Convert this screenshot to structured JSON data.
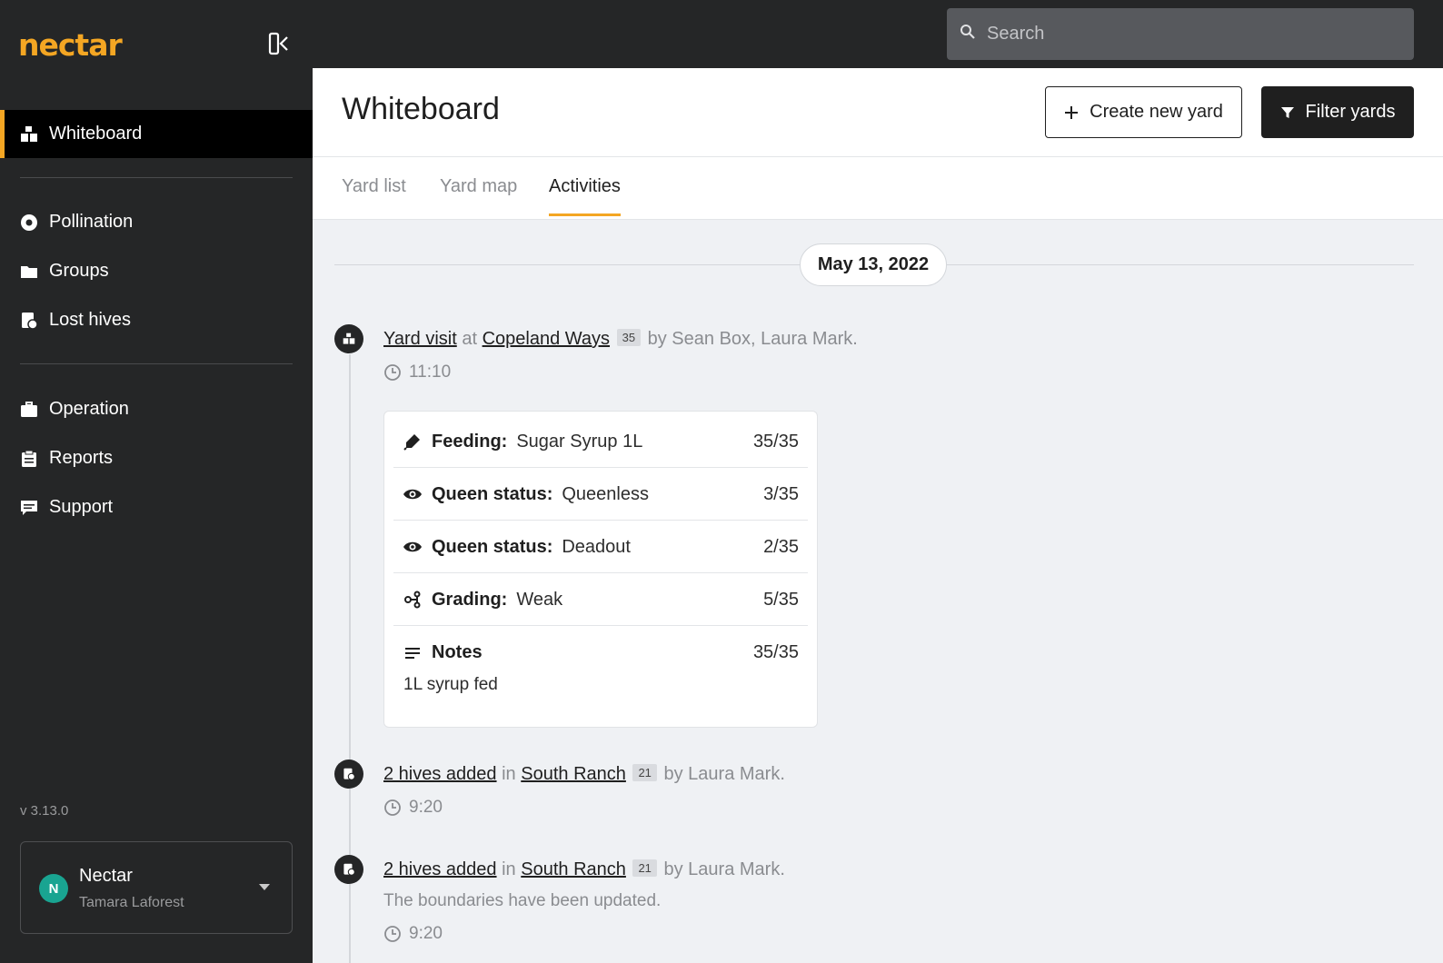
{
  "app": {
    "logo": "nectar",
    "version": "v 3.13.0"
  },
  "sidebar": {
    "items": [
      {
        "label": "Whiteboard",
        "icon": "hives-icon"
      },
      {
        "label": "Pollination",
        "icon": "flower-icon"
      },
      {
        "label": "Groups",
        "icon": "folder-icon"
      },
      {
        "label": "Lost hives",
        "icon": "lost-hive-icon"
      },
      {
        "label": "Operation",
        "icon": "briefcase-icon"
      },
      {
        "label": "Reports",
        "icon": "clipboard-icon"
      },
      {
        "label": "Support",
        "icon": "chat-icon"
      }
    ],
    "account": {
      "avatar_initial": "N",
      "name": "Nectar",
      "user": "Tamara Laforest"
    }
  },
  "search": {
    "placeholder": "Search"
  },
  "header": {
    "title": "Whiteboard",
    "create_label": "Create new yard",
    "filter_label": "Filter yards"
  },
  "tabs": [
    {
      "label": "Yard list",
      "active": false
    },
    {
      "label": "Yard map",
      "active": false
    },
    {
      "label": "Activities",
      "active": true
    }
  ],
  "date": "May 13, 2022",
  "activities": [
    {
      "action": "Yard visit",
      "preposition": "at",
      "yard": "Copeland Ways",
      "hive_count": "35",
      "by": "by Sean Box, Laura Mark.",
      "time": "11:10",
      "details": [
        {
          "icon": "syringe-icon",
          "label": "Feeding:",
          "value": "Sugar Syrup 1L",
          "count": "35/35"
        },
        {
          "icon": "eye-icon",
          "label": "Queen status:",
          "value": "Queenless",
          "count": "3/35"
        },
        {
          "icon": "eye-icon",
          "label": "Queen status:",
          "value": "Deadout",
          "count": "2/35"
        },
        {
          "icon": "grading-icon",
          "label": "Grading:",
          "value": "Weak",
          "count": "5/35"
        },
        {
          "icon": "notes-icon",
          "label": "Notes",
          "value": "",
          "count": "35/35"
        }
      ],
      "notes_text": "1L syrup fed"
    },
    {
      "action": "2 hives added",
      "preposition": "in",
      "yard": "South Ranch",
      "hive_count": "21",
      "by": "by Laura Mark.",
      "time": "9:20"
    },
    {
      "action": "2 hives added",
      "preposition": "in",
      "yard": "South Ranch",
      "hive_count": "21",
      "by": "by Laura Mark.",
      "note": "The boundaries have been updated.",
      "time": "9:20"
    }
  ],
  "colors": {
    "accent": "#f4a623",
    "sidebar_bg": "#252627",
    "avatar": "#19a491"
  }
}
